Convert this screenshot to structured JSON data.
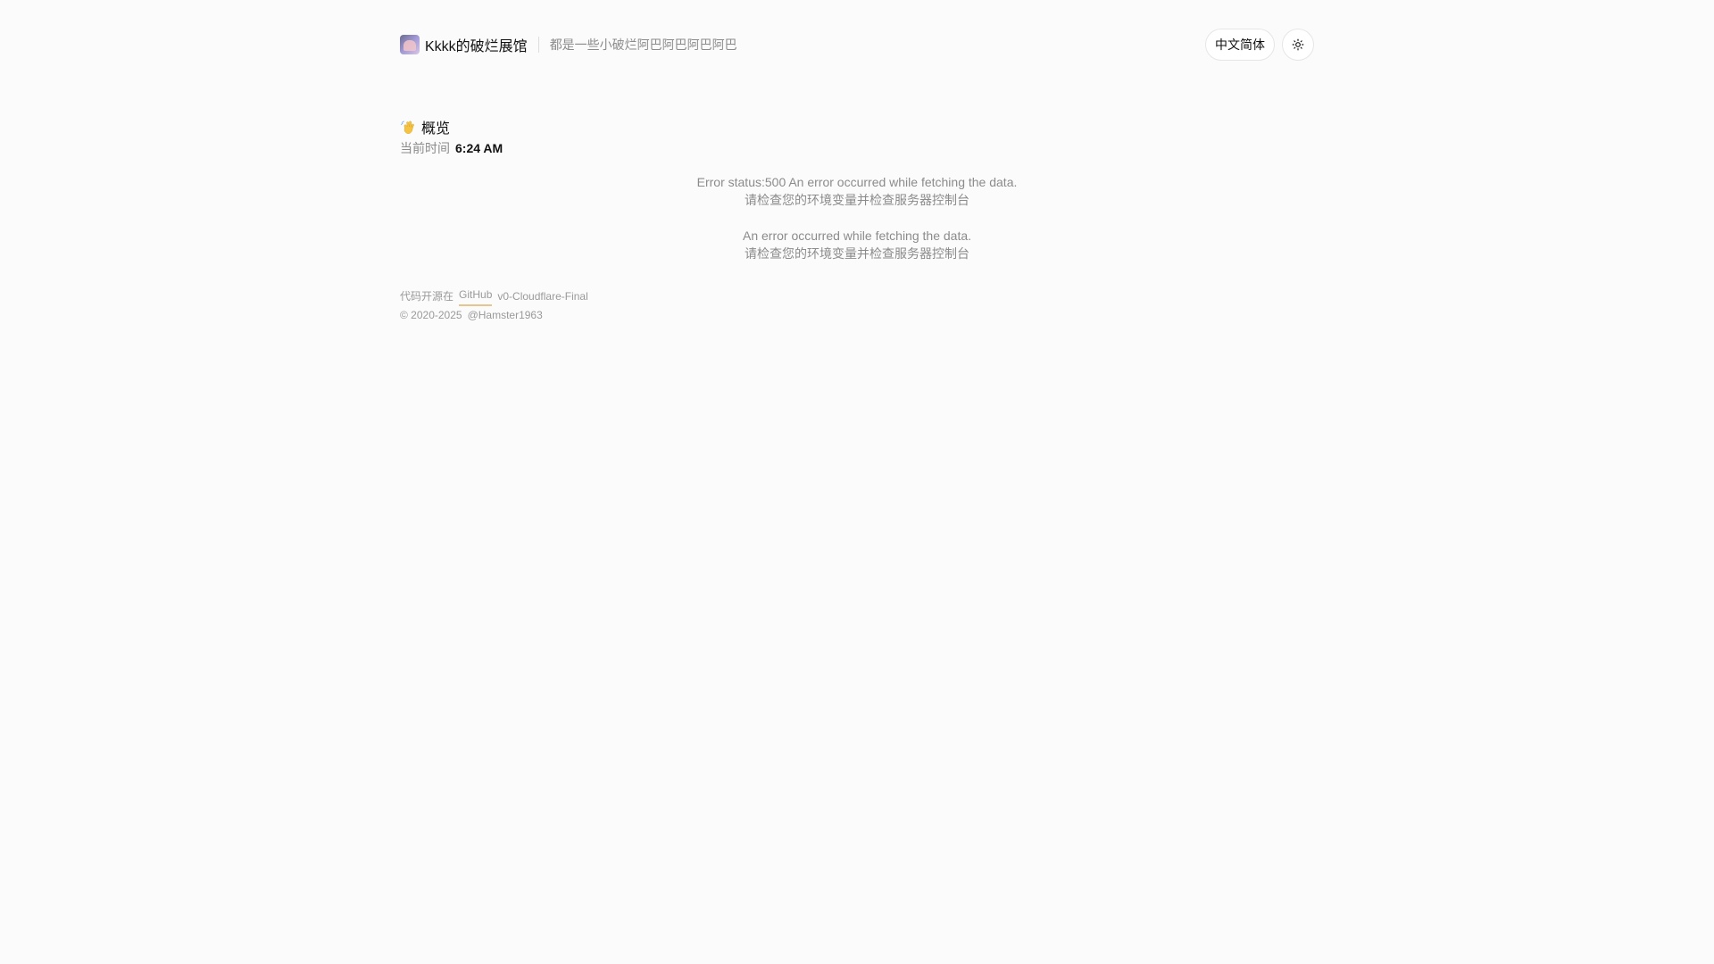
{
  "header": {
    "logo_icon": "avatar-logo",
    "title": "Kkkk的破烂展馆",
    "subtitle": "都是一些小破烂阿巴阿巴阿巴阿巴",
    "language_label": "中文简体",
    "theme_icon": "sun-icon"
  },
  "overview": {
    "icon": "waving-hand-icon",
    "title": "概览",
    "time_label": "当前时间",
    "time_value": "6:24 AM"
  },
  "errors": [
    {
      "line1": "Error status:500 An error occurred while fetching the data.",
      "line2": "请检查您的环境变量并检查服务器控制台"
    },
    {
      "line1": "An error occurred while fetching the data.",
      "line2": "请检查您的环境变量并检查服务器控制台"
    }
  ],
  "footer": {
    "open_source_prefix": "代码开源在",
    "github_link_text": "GitHub",
    "version": "v0-Cloudflare-Final",
    "copyright": "© 2020-2025",
    "author": "@Hamster1963"
  },
  "colors": {
    "background": "#fbfbfb",
    "text_primary": "#111111",
    "text_muted": "#8b8b8b",
    "link_underline": "#e6c68c"
  }
}
